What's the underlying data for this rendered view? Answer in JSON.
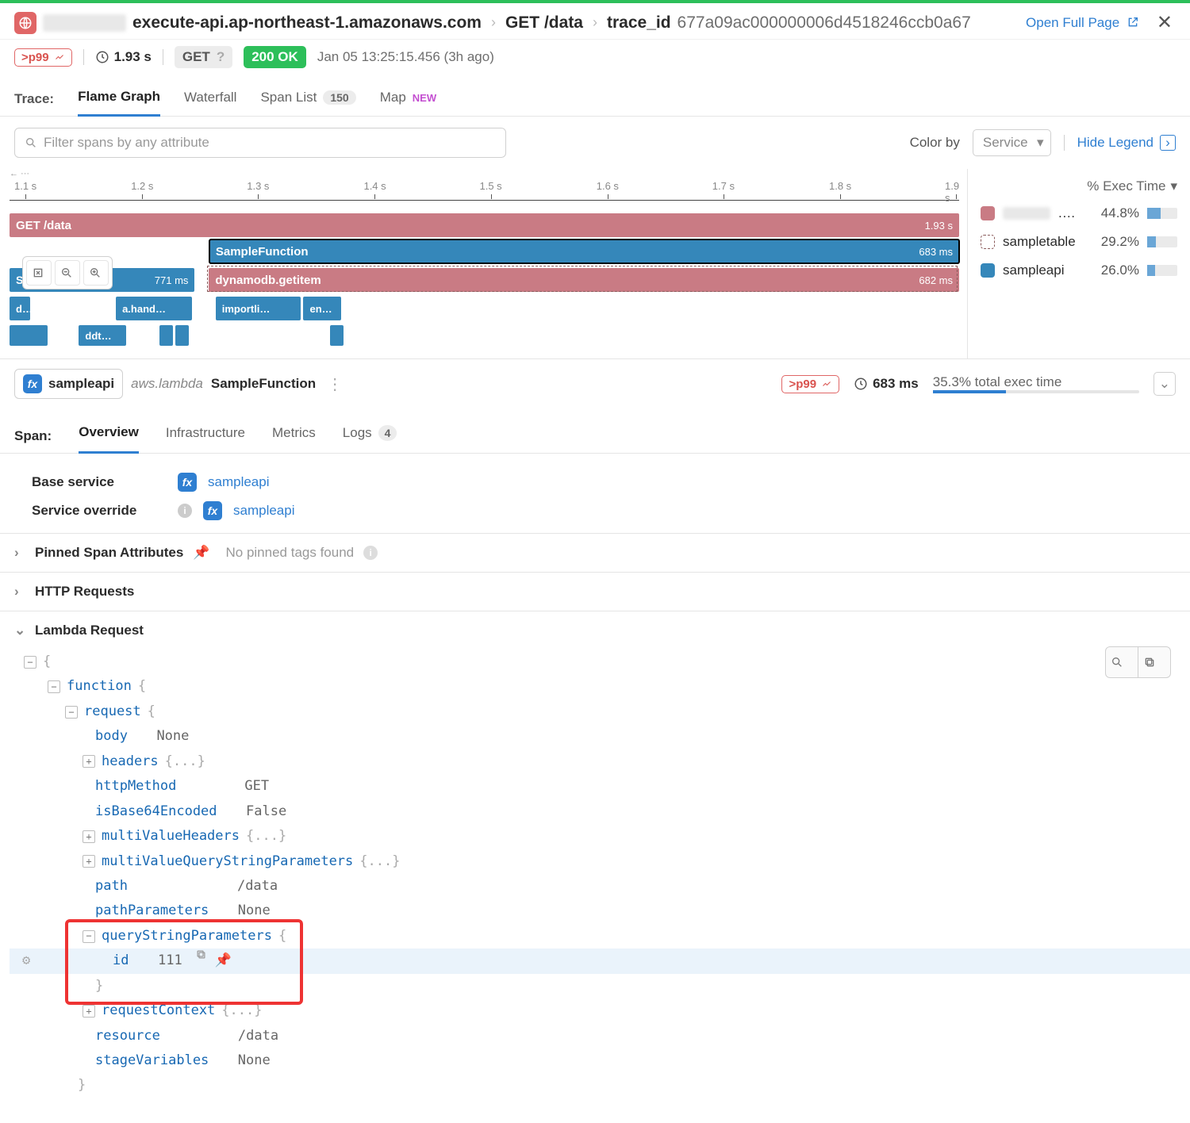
{
  "header": {
    "host_suffix": "execute-api.ap-northeast-1.amazonaws.com",
    "endpoint": "GET /data",
    "trace_label": "trace_id",
    "trace_id": "677a09ac000000006d4518246ccb0a67",
    "open_full": "Open Full Page"
  },
  "row2": {
    "p99": ">p99",
    "duration": "1.93 s",
    "method": "GET",
    "method_q": "?",
    "status": "200 OK",
    "ts": "Jan 05 13:25:15.456 (3h ago)"
  },
  "trace_tabs": {
    "label": "Trace:",
    "flame": "Flame Graph",
    "waterfall": "Waterfall",
    "spanlist": "Span List",
    "spanlist_count": "150",
    "map": "Map",
    "new": "NEW"
  },
  "filter": {
    "placeholder": "Filter spans by any attribute",
    "colorby": "Color by",
    "colorby_val": "Service",
    "hide_legend": "Hide Legend"
  },
  "ruler": {
    "ticks": [
      "1.1 s",
      "1.2 s",
      "1.3 s",
      "1.4 s",
      "1.5 s",
      "1.6 s",
      "1.7 s",
      "1.8 s",
      "1.9 s"
    ]
  },
  "spans": {
    "root_label": "GET  /data",
    "root_dur": "1.93 s",
    "sel_label": "SampleFunction",
    "sel_dur": "683 ms",
    "sf_left_label": "SampleFunction",
    "sf_left_dur": "771 ms",
    "ddb_label": "dynamodb.getitem",
    "ddb_dur": "682 ms",
    "sm1": "d…",
    "sm2": "a.hand…",
    "sm3": "importli…",
    "sm4": "en…",
    "sm5": "ddt…"
  },
  "legend": {
    "head": "% Exec Time",
    "rows": [
      {
        "name": ".exec…",
        "pct": "44.8%",
        "fill": 44.8,
        "color": "#c97b84",
        "dashed": false
      },
      {
        "name": "sampletable",
        "pct": "29.2%",
        "fill": 29.2,
        "color": "#c97b84",
        "dashed": true
      },
      {
        "name": "sampleapi",
        "pct": "26.0%",
        "fill": 26.0,
        "color": "#3587ba",
        "dashed": false
      }
    ]
  },
  "span_detail": {
    "svc": "sampleapi",
    "sub": "aws.lambda",
    "res": "SampleFunction",
    "p99": ">p99",
    "dur": "683 ms",
    "pct": "35.3% total exec time",
    "fill": 35.3,
    "tabs": {
      "label": "Span:",
      "overview": "Overview",
      "infra": "Infrastructure",
      "metrics": "Metrics",
      "logs": "Logs",
      "logs_count": "4"
    },
    "rows": {
      "base_k": "Base service",
      "base_v": "sampleapi",
      "ovr_k": "Service override",
      "ovr_v": "sampleapi"
    }
  },
  "sections": {
    "pinned": "Pinned Span Attributes",
    "pinned_sub": "No pinned tags found",
    "http": "HTTP Requests",
    "lambda": "Lambda Request"
  },
  "json": {
    "function": "function",
    "request": "request",
    "body": "body",
    "body_v": "None",
    "headers": "headers",
    "ell": "{...}",
    "httpMethod": "httpMethod",
    "httpMethod_v": "GET",
    "isBase64": "isBase64Encoded",
    "isBase64_v": "False",
    "mvh": "multiValueHeaders",
    "mvq": "multiValueQueryStringParameters",
    "path": "path",
    "path_v": "/data",
    "pathParams": "pathParameters",
    "pathParams_v": "None",
    "qsp": "queryStringParameters",
    "id": "id",
    "id_v": "111",
    "reqctx": "requestContext",
    "resource": "resource",
    "resource_v": "/data",
    "stage": "stageVariables",
    "stage_v": "None"
  }
}
